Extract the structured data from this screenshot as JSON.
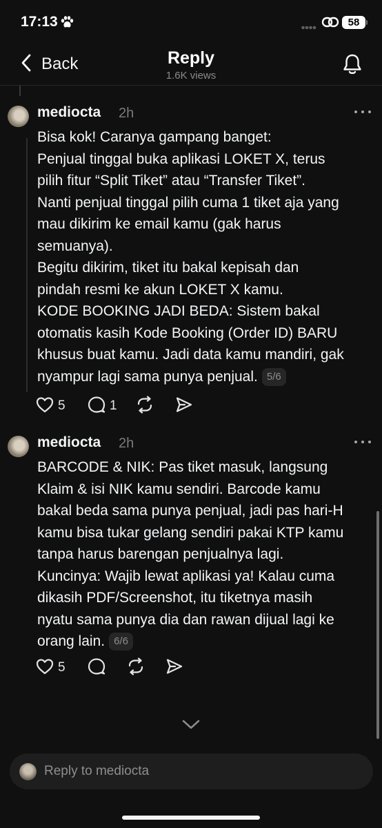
{
  "status_bar": {
    "time": "17:13",
    "battery": "58"
  },
  "nav": {
    "back_label": "Back",
    "title": "Reply",
    "subtitle": "1.6K views"
  },
  "posts": [
    {
      "username": "mediocta",
      "time": "2h",
      "lines": [
        "Bisa kok! Caranya gampang banget:",
        "Penjual tinggal buka aplikasi LOKET X, terus",
        "pilih fitur “Split Tiket” atau “Transfer Tiket”.",
        "Nanti penjual tinggal pilih cuma 1 tiket aja yang",
        "mau dikirim ke email kamu (gak harus",
        "semuanya).",
        "Begitu dikirim, tiket itu bakal kepisah dan",
        "pindah resmi ke akun LOKET X kamu.",
        "KODE BOOKING JADI BEDA: Sistem bakal",
        "otomatis kasih Kode Booking (Order ID) BARU",
        "khusus buat kamu. Jadi data kamu mandiri, gak",
        "nyampur lagi sama punya penjual."
      ],
      "page_badge": "5/6",
      "likes": "5",
      "replies": "1"
    },
    {
      "username": "mediocta",
      "time": "2h",
      "lines": [
        "BARCODE & NIK: Pas tiket masuk, langsung",
        "Klaim & isi NIK kamu sendiri. Barcode kamu",
        "bakal beda sama punya penjual, jadi pas hari-H",
        "kamu bisa tukar gelang sendiri pakai KTP kamu",
        "tanpa harus barengan penjualnya lagi.",
        "Kuncinya: Wajib lewat aplikasi ya! Kalau cuma",
        "dikasih PDF/Screenshot, itu tiketnya masih",
        "nyatu sama punya dia dan rawan dijual lagi ke",
        "orang lain."
      ],
      "page_badge": "6/6",
      "likes": "5",
      "replies": ""
    }
  ],
  "reply_bar": {
    "placeholder": "Reply to mediocta"
  },
  "icons": {
    "back": "chevron-left-icon",
    "bell": "bell-icon",
    "like": "heart-icon",
    "reply": "comment-icon",
    "repost": "repost-icon",
    "share": "send-icon",
    "more": "more-horizontal-icon",
    "expand": "chevron-down-icon"
  },
  "colors": {
    "background": "#101010",
    "text": "#f3f5f7",
    "muted": "#7a7a7a"
  }
}
